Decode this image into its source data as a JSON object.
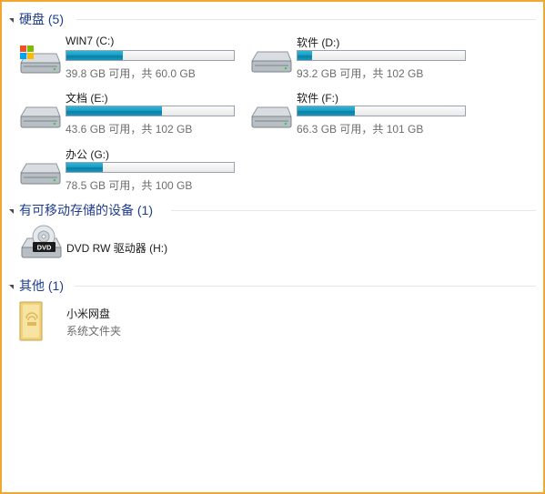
{
  "groups": {
    "hard_disks": {
      "title": "硬盘 (5)"
    },
    "removable": {
      "title": "有可移动存储的设备 (1)"
    },
    "other": {
      "title": "其他 (1)"
    }
  },
  "drives": [
    {
      "name": "WIN7 (C:)",
      "info": "39.8 GB 可用，共 60.0 GB",
      "used_fraction": 0.337,
      "icon": "windows-drive-icon"
    },
    {
      "name": "软件 (D:)",
      "info": "93.2 GB 可用，共 102 GB",
      "used_fraction": 0.086,
      "icon": "hard-drive-icon"
    },
    {
      "name": "文档 (E:)",
      "info": "43.6 GB 可用，共 102 GB",
      "used_fraction": 0.573,
      "icon": "hard-drive-icon"
    },
    {
      "name": "软件 (F:)",
      "info": "66.3 GB 可用，共 101 GB",
      "used_fraction": 0.344,
      "icon": "hard-drive-icon"
    },
    {
      "name": "办公 (G:)",
      "info": "78.5 GB 可用，共 100 GB",
      "used_fraction": 0.215,
      "icon": "hard-drive-icon"
    }
  ],
  "removable_devices": [
    {
      "name": "DVD RW 驱动器 (H:)",
      "icon": "dvd-drive-icon",
      "icon_label": "DVD"
    }
  ],
  "other_items": [
    {
      "name": "小米网盘",
      "subtitle": "系统文件夹",
      "icon": "folder-icon"
    }
  ],
  "colors": {
    "bar_fill": "#1596bd",
    "group_title": "#1e3d8f",
    "frame": "#f0a830"
  }
}
